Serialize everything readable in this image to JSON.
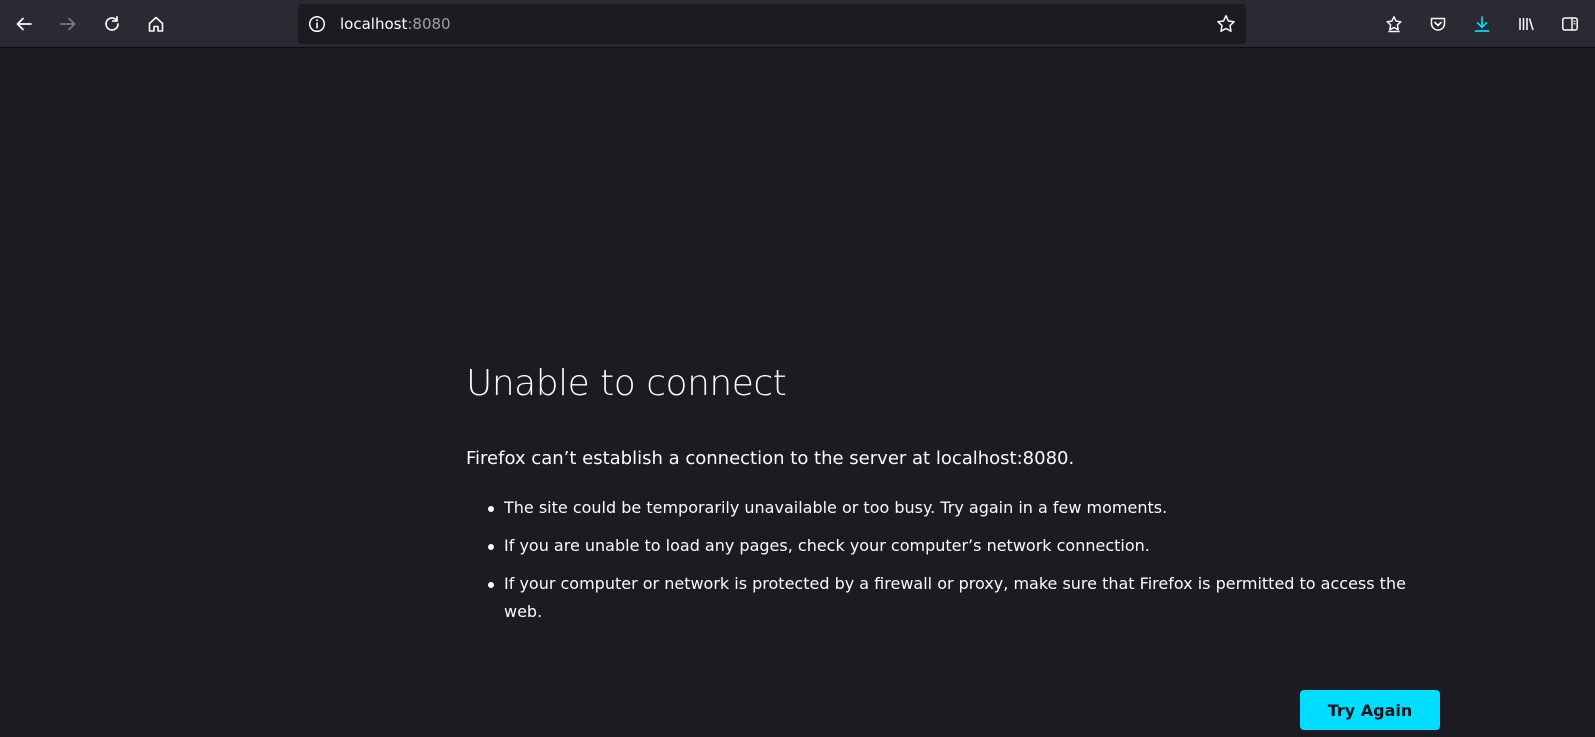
{
  "toolbar": {
    "nav_buttons": [
      {
        "icon": "back-arrow-icon"
      },
      {
        "icon": "forward-arrow-icon"
      },
      {
        "icon": "reload-icon"
      },
      {
        "icon": "home-icon"
      }
    ],
    "url": {
      "host": "localhost",
      "port": ":8080",
      "info_icon": "info-circle-icon",
      "bookmark_icon": "star-outline-icon"
    },
    "right_buttons": [
      {
        "icon": "bookmarks-star-icon"
      },
      {
        "icon": "pocket-icon"
      },
      {
        "icon": "download-icon"
      },
      {
        "icon": "library-icon"
      },
      {
        "icon": "sidebar-icon"
      }
    ]
  },
  "error": {
    "title": "Unable to connect",
    "subtitle": "Firefox can’t establish a connection to the server at localhost:8080.",
    "reasons": [
      "The site could be temporarily unavailable or too busy. Try again in a few moments.",
      "If you are unable to load any pages, check your computer’s network connection.",
      "If your computer or network is protected by a firewall or proxy, make sure that Firefox is permitted to access the web."
    ],
    "try_again_label": "Try Again"
  },
  "colors": {
    "page_bg": "#1c1b22",
    "toolbar_bg": "#2b2a33",
    "accent": "#00ddff",
    "text": "#fbfbfe",
    "muted": "#9e9ea6"
  }
}
